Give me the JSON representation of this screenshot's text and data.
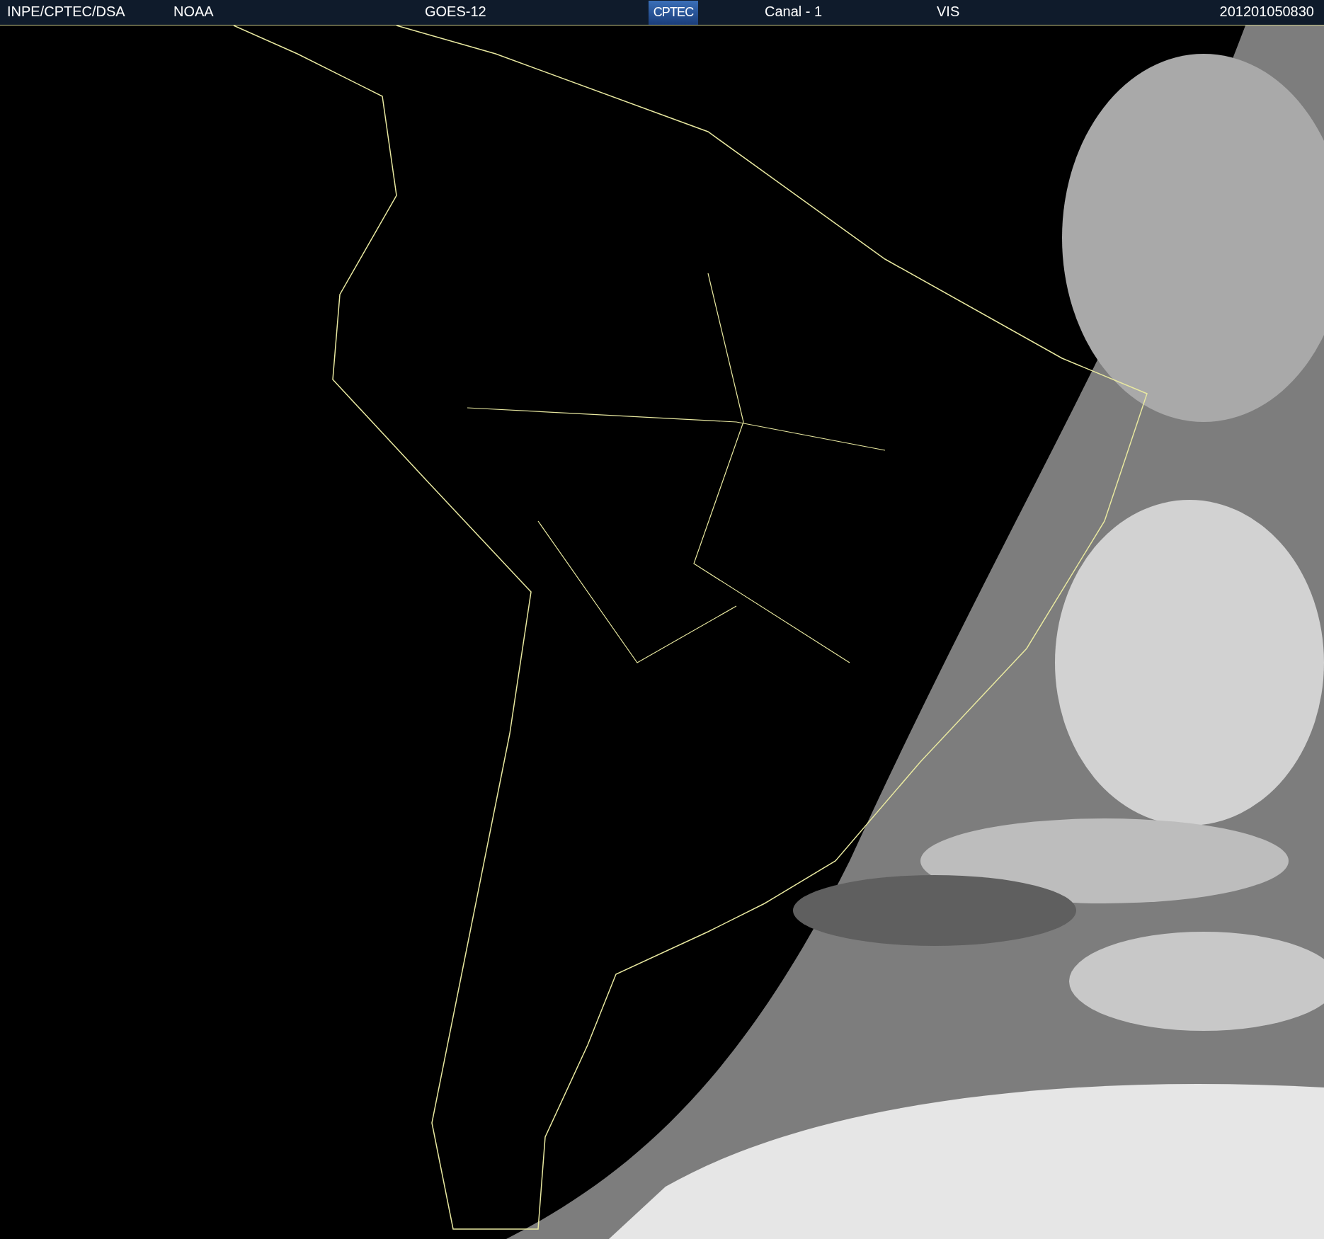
{
  "header": {
    "agency": "INPE/CPTEC/DSA",
    "source": "NOAA",
    "satellite": "GOES-12",
    "logo": "CPTEC",
    "channel": "Canal - 1",
    "band": "VIS",
    "timestamp": "201201050830"
  }
}
